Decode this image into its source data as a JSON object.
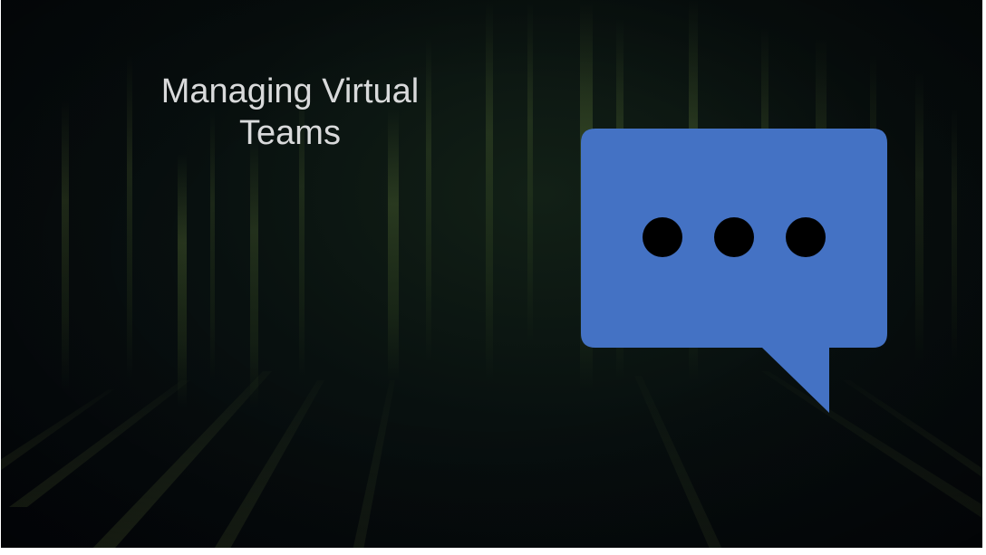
{
  "slide": {
    "title_lines": [
      "Managing Virtual",
      "Teams"
    ],
    "icon": "speech-bubble-ellipsis-icon",
    "colors": {
      "background": "#05090d",
      "title_text": "#d9dadb",
      "bubble_fill": "#4472c4",
      "dots": "#000000",
      "streaks": "#6f8a3a"
    }
  }
}
